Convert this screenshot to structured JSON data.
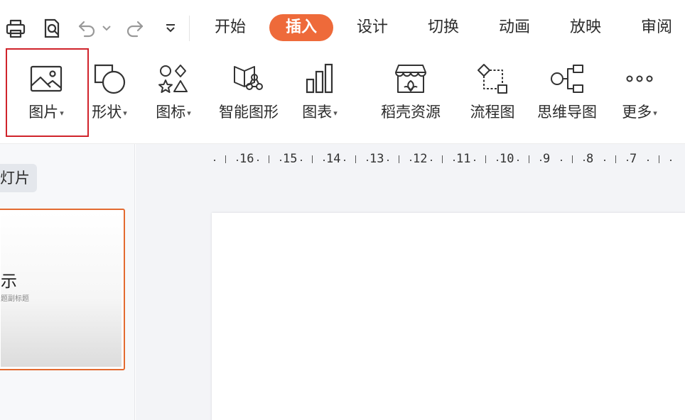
{
  "quick_access": {
    "icons": [
      "print-icon",
      "print-preview-icon",
      "undo-icon",
      "undo-dropdown-icon",
      "redo-icon",
      "customize-dropdown-icon"
    ]
  },
  "tabs": [
    {
      "label": "开始",
      "active": false
    },
    {
      "label": "插入",
      "active": true
    },
    {
      "label": "设计",
      "active": false
    },
    {
      "label": "切换",
      "active": false
    },
    {
      "label": "动画",
      "active": false
    },
    {
      "label": "放映",
      "active": false
    },
    {
      "label": "审阅",
      "active": false
    }
  ],
  "ribbon": {
    "picture": "图片",
    "shape": "形状",
    "icon": "图标",
    "smart_art": "智能图形",
    "chart": "图表",
    "docer": "稻壳资源",
    "flowchart": "流程图",
    "mindmap": "思维导图",
    "more": "更多",
    "caret": "▾"
  },
  "side_panel": {
    "slides_tab": "灯片",
    "thumb_title": "示",
    "thumb_sub": "题副标题"
  },
  "ruler": {
    "numbers": [
      "16",
      "15",
      "14",
      "13",
      "12",
      "11",
      "10",
      "9",
      "8",
      "7"
    ]
  },
  "colors": {
    "accent": "#ee6a3a",
    "highlight_box": "#d0232b",
    "thumb_border": "#e36a30"
  }
}
